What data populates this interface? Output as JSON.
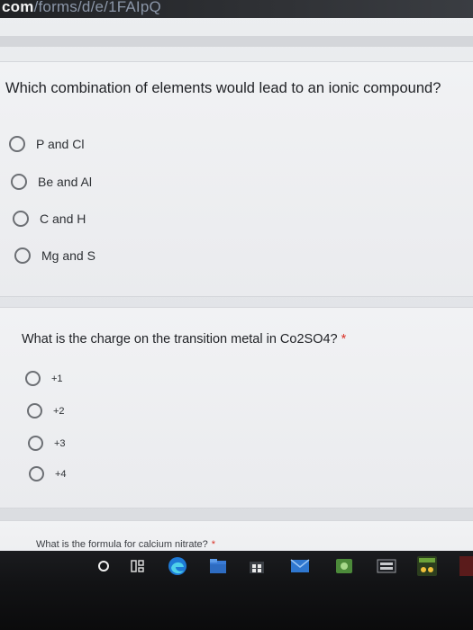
{
  "browser": {
    "url_visible_prefix": "com",
    "url_visible_rest": "/forms/d/e/1FAIpQ"
  },
  "questions": [
    {
      "text": "Which combination of elements would lead to an ionic compound?",
      "required_mark": "",
      "options": [
        "P and Cl",
        "Be and Al",
        "C and H",
        "Mg and S"
      ]
    },
    {
      "text": "What is the charge on the transition metal in Co2SO4?",
      "required_mark": "*",
      "options": [
        "+1",
        "+2",
        "+3",
        "+4"
      ]
    },
    {
      "text": "What is the formula for calcium nitrate?",
      "required_mark": "*"
    }
  ],
  "taskbar": {
    "icons": [
      "search-circle-icon",
      "task-view-icon",
      "edge-browser-icon",
      "file-explorer-icon",
      "store-icon",
      "mail-icon",
      "app-icon",
      "keyboard-icon",
      "game-icon"
    ]
  },
  "colors": {
    "required": "#d93025",
    "taskbar": "#121315",
    "page": "#eceef0"
  }
}
